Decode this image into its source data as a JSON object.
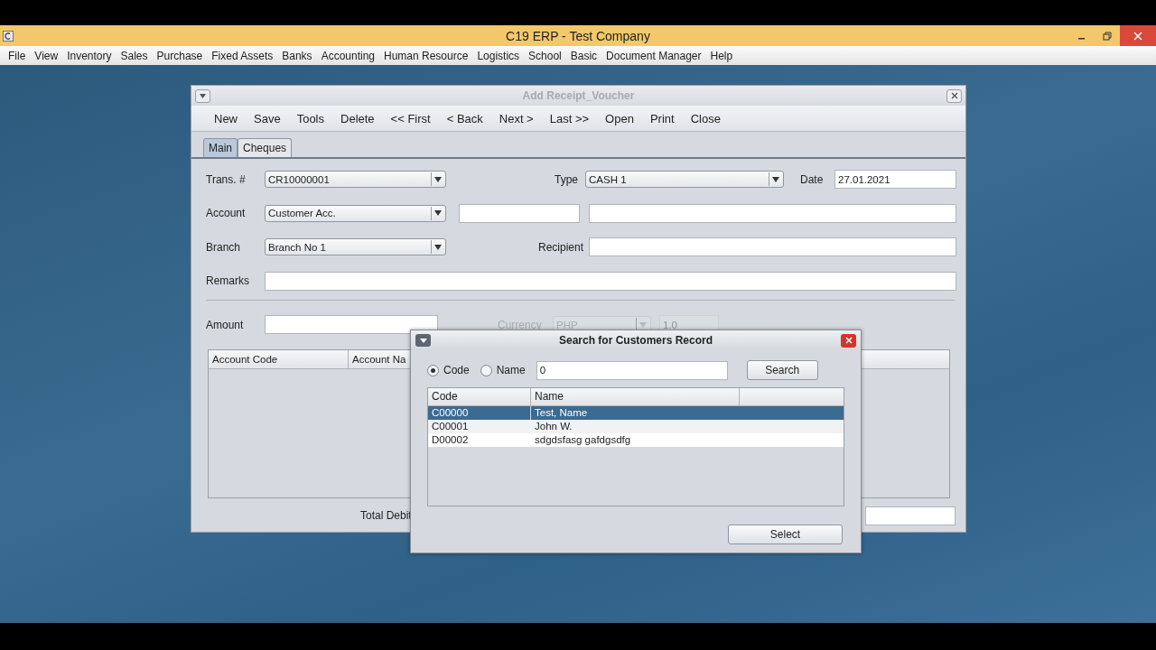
{
  "app": {
    "title": "C19 ERP - Test Company"
  },
  "menu": [
    "File",
    "View",
    "Inventory",
    "Sales",
    "Purchase",
    "Fixed Assets",
    "Banks",
    "Accounting",
    "Human Resource",
    "Logistics",
    "School",
    "Basic",
    "Document Manager",
    "Help"
  ],
  "voucher_window": {
    "title": "Add Receipt_Voucher",
    "toolbar": [
      "New",
      "Save",
      "Tools",
      "Delete",
      "<< First",
      "< Back",
      "Next >",
      "Last >>",
      "Open",
      "Print",
      "Close"
    ],
    "tabs": [
      {
        "label": "Main",
        "selected": true
      },
      {
        "label": "Cheques",
        "selected": false
      }
    ],
    "trans_no": {
      "label": "Trans. #",
      "kind": "combo",
      "value": "CR10000001"
    },
    "type": {
      "label": "Type",
      "kind": "combo",
      "value": "CASH 1"
    },
    "date": {
      "label": "Date",
      "kind": "text",
      "value": "27.01.2021"
    },
    "account": {
      "label": "Account",
      "kind": "combo",
      "value": "Customer Acc."
    },
    "branch": {
      "label": "Branch",
      "kind": "combo",
      "value": "Branch No 1"
    },
    "recipient": {
      "label": "Recipient",
      "kind": "text"
    },
    "remarks": {
      "label": "Remarks",
      "kind": "text"
    },
    "amount": {
      "label": "Amount",
      "kind": "text"
    },
    "currency": {
      "label": "Currency",
      "kind": "combo",
      "value": "PHP",
      "disabled": true
    },
    "rate": {
      "kind": "text",
      "value": "1.0",
      "disabled": true
    },
    "table": {
      "columns": [
        "Account Code",
        "Account Na"
      ]
    },
    "total_debit": {
      "label": "Total Debit"
    }
  },
  "search_dialog": {
    "title": "Search for Customers Record",
    "options": [
      {
        "label": "Code",
        "selected": true
      },
      {
        "label": "Name",
        "selected": false
      }
    ],
    "query": "0",
    "search_button": "Search",
    "columns": [
      "Code",
      "Name"
    ],
    "rows": [
      {
        "code": "C00000",
        "name": "Test, Name",
        "selected": true
      },
      {
        "code": "C00001",
        "name": "John W.",
        "selected": false
      },
      {
        "code": "D00002",
        "name": "sdgdsfasg gafdgsdfg",
        "selected": false
      }
    ],
    "select_button": "Select"
  }
}
